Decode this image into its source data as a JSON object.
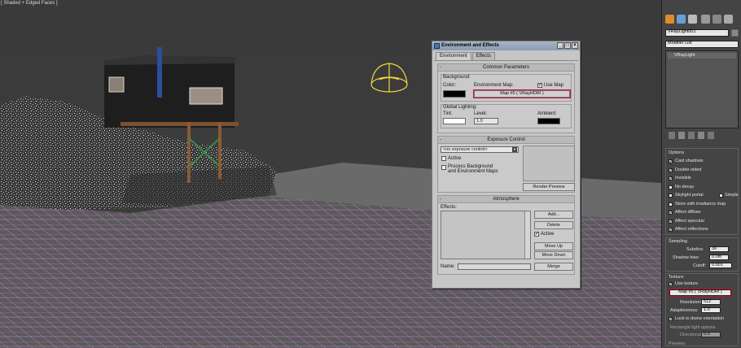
{
  "viewport": {
    "label": "[ Shaded + Edged Faces ]"
  },
  "dialog": {
    "title": "Environment and Effects",
    "tabs": [
      "Environment",
      "Effects"
    ],
    "common": {
      "header": "Common Parameters",
      "background": "Background:",
      "color": "Color:",
      "env_map": "Environment Map:",
      "use_map": "Use Map",
      "map_button": "Map #5  ( VRayHDRI )",
      "global": "Global Lighting:",
      "tint": "Tint:",
      "level": "Level:",
      "level_value": "1.0",
      "ambient": "Ambient:"
    },
    "exposure": {
      "header": "Exposure Control",
      "dropdown": "<no exposure control>",
      "active": "Active",
      "process_bg": "Process Background",
      "process_bg2": "and Environment Maps",
      "render_preview": "Render Preview"
    },
    "atmosphere": {
      "header": "Atmosphere",
      "effects": "Effects:",
      "add": "Add...",
      "delete": "Delete",
      "active": "Active",
      "move_up": "Move Up",
      "move_down": "Move Down",
      "name": "Name:",
      "merge": "Merge"
    }
  },
  "panel": {
    "object_name": "VRayLight001",
    "modifier_list": "Modifier List",
    "stack_item": "VRayLight",
    "options": {
      "header": "Options",
      "items": [
        "Cast shadows",
        "Double-sided",
        "Invisible",
        "No decay",
        "Skylight portal",
        "Store with irradiance map",
        "Affect diffuse",
        "Affect specular",
        "Affect reflections"
      ],
      "simple": "Simple"
    },
    "sampling": {
      "header": "Sampling",
      "subdivs": "Subdivs:",
      "subdivs_val": "30",
      "shadow_bias": "Shadow bias:",
      "shadow_bias_val": "0.0m",
      "cutoff": "Cutoff:",
      "cutoff_val": "0.001"
    },
    "texture": {
      "header": "Texture:",
      "use_texture": "Use texture",
      "map": "Map #5  ( VRayHDRI )",
      "resolution": "Resolution:",
      "resolution_val": "512",
      "adaptiveness": "Adaptiveness:",
      "adaptiveness_val": "1.0",
      "lock": "Lock to dome orientation",
      "rect": "Rectangle light options",
      "directional": "Directional:",
      "directional_val": "0.0",
      "preview": "Preview:"
    }
  },
  "colors": {
    "highlight": "#c8102e",
    "wire": "#c77dd6",
    "title": "#8a9bb3"
  }
}
